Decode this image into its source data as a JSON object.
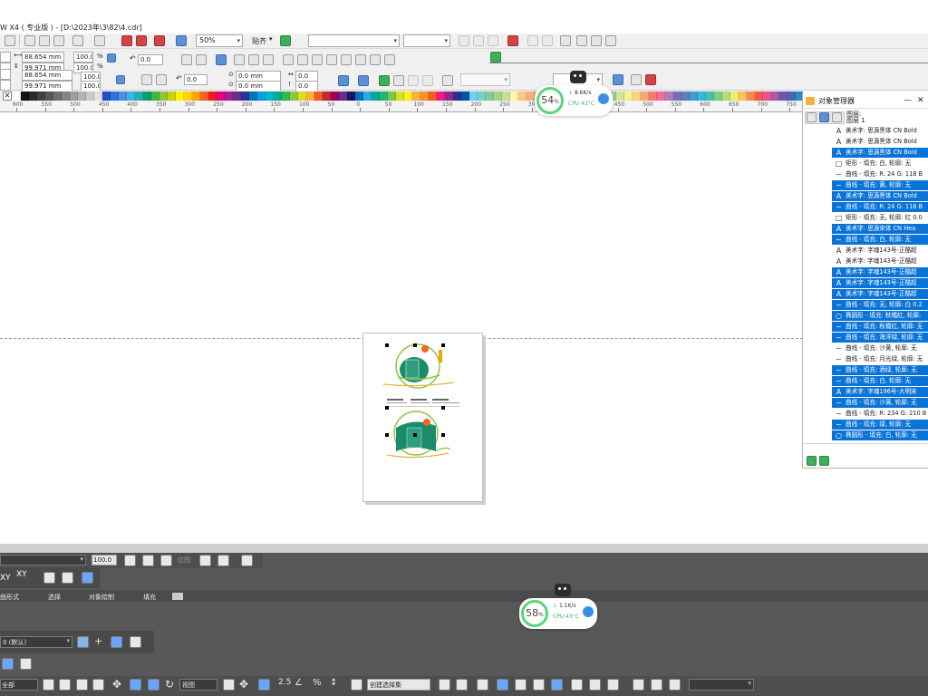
{
  "window": {
    "title": "W X4 ( 专业版 ) - [D:\\2023年\\3\\82\\4.cdr]"
  },
  "toolbar": {
    "zoom": "50%",
    "snap_label": "贴齐"
  },
  "property_bar": {
    "width_top": "88.654 mm",
    "height_top": "99.971 mm",
    "scale_x_top": "100.0",
    "scale_y_top": "100.0",
    "percent": "%",
    "width_bottom": "88.654 mm",
    "height_bottom": "99.971 mm",
    "scale_x_bottom": "100.0",
    "scale_y_bottom": "100.0",
    "rotation_top": "0.0",
    "rotation_bottom": "0.0",
    "offset_x": "0.0 mm",
    "offset_y": "0.0 mm",
    "spin_a": "0.0",
    "spin_b": "0.0"
  },
  "ruler": {
    "ticks": [
      "600",
      "550",
      "500",
      "450",
      "400",
      "350",
      "300",
      "250",
      "200",
      "150",
      "100",
      "50",
      "0",
      "50",
      "100",
      "150",
      "200",
      "250",
      "300",
      "350",
      "400",
      "450",
      "500",
      "550",
      "600",
      "650",
      "700",
      "750"
    ]
  },
  "palette": [
    "#ffffff",
    "#141414",
    "#2a2a2a",
    "#404040",
    "#575757",
    "#6e6e6e",
    "#858585",
    "#9c9c9c",
    "#b3b3b3",
    "#cacaca",
    "#e1e1e1",
    "#1f4fbf",
    "#2f74d8",
    "#4a90e2",
    "#3cb4e6",
    "#20b2aa",
    "#0aa06e",
    "#40b840",
    "#8cc63f",
    "#c8d400",
    "#fff200",
    "#ffd200",
    "#f7a600",
    "#f26522",
    "#ed1c24",
    "#e4007f",
    "#a3238e",
    "#662d91",
    "#2e3192",
    "#0072bc",
    "#00a0e9",
    "#00b7c3",
    "#00a99d",
    "#39b54a",
    "#8dc63f",
    "#d7df23",
    "#fbb03b",
    "#f15a24",
    "#c1272d",
    "#9e005d",
    "#662d91",
    "#1b1464",
    "#0071bc",
    "#29abe2",
    "#00a99d",
    "#22b573",
    "#7ac943",
    "#d9e021",
    "#fcee21",
    "#fbb03b",
    "#f7931e",
    "#f15a24",
    "#ed1e79",
    "#93278f",
    "#2e3192",
    "#0054a6",
    "#6dcff6",
    "#7accc8",
    "#82ca9c",
    "#a8d08d",
    "#c4df9b",
    "#fff799",
    "#fdc689",
    "#f9ad81",
    "#f69679",
    "#f49ac1",
    "#bd8cbf",
    "#8781bd",
    "#8393ca",
    "#7da7d9",
    "#6dcff6",
    "#4cc3d9",
    "#5fc9a9",
    "#9fd29f",
    "#d4e59a",
    "#f6ef8a",
    "#fbd27f",
    "#f8a672",
    "#f47c68",
    "#f26c9b",
    "#b07cb8",
    "#796fb5",
    "#5e7cc1",
    "#3f9ad6",
    "#35b9d9",
    "#46c0b0",
    "#7ccc8d",
    "#b9da7b",
    "#f0ec6c",
    "#f9c25f",
    "#f58d4f",
    "#f05a4d",
    "#ec4f8a",
    "#a25fa8",
    "#6a5aa8",
    "#4a66b3",
    "#2f86cc",
    "#1fa5cf",
    "#2cb39f",
    "#60c07b",
    "#a9d268",
    "#ece35a",
    "#f7b34a",
    "#f37d3c",
    "#ee4a3d",
    "#ea3d78",
    "#944e98",
    "#584b99",
    "#3756a6",
    "#1d76c0",
    "#0e94c4",
    "#19a38f",
    "#4bb16b",
    "#99c557",
    "#e6d84a",
    "#f4a239",
    "#f06d2c",
    "#eb3a2e",
    "#e62e69",
    "#853e89",
    "#4c3c8a",
    "#284999",
    "#0e68b4",
    "#0085b8",
    "#0a947f",
    "#3aa25b",
    "#8ab847",
    "#e0cc3b",
    "#f1922a",
    "#ed5e1e",
    "#e82c21",
    "#e3215b"
  ],
  "docker": {
    "title": "对象管理器",
    "layer_label": "图层:",
    "layer_name": "图层 1",
    "objects": [
      {
        "icon": "A",
        "text": "美术字: 思源黑体 CN Bold",
        "sel": false
      },
      {
        "icon": "A",
        "text": "美术字: 思源黑体 CN Bold",
        "sel": false
      },
      {
        "icon": "A",
        "text": "美术字: 思源黑体 CN Bold",
        "sel": true
      },
      {
        "icon": "□",
        "text": "矩形 - 填充: 白, 轮廓: 无",
        "sel": false
      },
      {
        "icon": "~",
        "text": "曲线 - 填充: R: 24 G: 118 B",
        "sel": false
      },
      {
        "icon": "~",
        "text": "曲线 - 填充: 黄, 轮廓: 无",
        "sel": true
      },
      {
        "icon": "A",
        "text": "美术字: 思源黑体 CN Bold",
        "sel": true
      },
      {
        "icon": "~",
        "text": "曲线 - 填充: R: 24 G: 118 B",
        "sel": true
      },
      {
        "icon": "□",
        "text": "矩形 - 填充: 无, 轮廓: 红 0.0",
        "sel": false
      },
      {
        "icon": "A",
        "text": "美术字: 思源宋体 CN Hea",
        "sel": true
      },
      {
        "icon": "~",
        "text": "曲线 - 填充: 白, 轮廓: 无",
        "sel": true
      },
      {
        "icon": "A",
        "text": "美术字: 字魂143号-正酷超",
        "sel": false
      },
      {
        "icon": "A",
        "text": "美术字: 字魂143号-正酷超",
        "sel": false
      },
      {
        "icon": "A",
        "text": "美术字: 字魂143号-正酷超",
        "sel": true
      },
      {
        "icon": "A",
        "text": "美术字: 字魂143号-正酷超",
        "sel": true
      },
      {
        "icon": "A",
        "text": "美术字: 字魂143号-正酷超",
        "sel": true
      },
      {
        "icon": "~",
        "text": "曲线 - 填充: 无, 轮廓: 白 0.2",
        "sel": true
      },
      {
        "icon": "○",
        "text": "椭圆形 - 填充: 秋橘红, 轮廓:",
        "sel": true
      },
      {
        "icon": "~",
        "text": "曲线 - 填充: 秋橘红, 轮廓: 无",
        "sel": true
      },
      {
        "icon": "~",
        "text": "曲线 - 填充: 海洋绿, 轮廓: 无",
        "sel": true
      },
      {
        "icon": "~",
        "text": "曲线 - 填充: 沙黄, 轮廓: 无",
        "sel": false
      },
      {
        "icon": "~",
        "text": "曲线 - 填充: 月光绿, 轮廓: 无",
        "sel": false
      },
      {
        "icon": "~",
        "text": "曲线 - 填充: 酒绿, 轮廓: 无",
        "sel": true
      },
      {
        "icon": "~",
        "text": "曲线 - 填充: 白, 轮廓: 无",
        "sel": true
      },
      {
        "icon": "A",
        "text": "美术字: 字魂196号-大明宋",
        "sel": true
      },
      {
        "icon": "~",
        "text": "曲线 - 填充: 沙黄, 轮廓: 无",
        "sel": true
      },
      {
        "icon": "~",
        "text": "曲线 - 填充: R: 234 G: 210 B",
        "sel": false
      },
      {
        "icon": "~",
        "text": "曲线 - 填充: 绿, 轮廓: 无",
        "sel": true
      },
      {
        "icon": "○",
        "text": "椭圆形 - 填充: 白, 轮廓: 无",
        "sel": true
      }
    ]
  },
  "meter_top": {
    "percent": "54",
    "unit": "%",
    "speed": "8.6K/s",
    "cpu": "CPU 43°C"
  },
  "meter_bottom": {
    "percent": "58",
    "unit": "%",
    "speed": "1.1K/s",
    "cpu": "CPU 43°C"
  },
  "lower_panel": {
    "row1_value": "100.0",
    "row1_label": "位图",
    "tabs": [
      "曲形式",
      "选择",
      "对象绘制",
      "填充"
    ],
    "layer_default": "0 (默认)",
    "bottom_all": "全部",
    "bottom_view": "视图",
    "bottom_selset": "创建选择集",
    "bottom_num": "2.5"
  }
}
